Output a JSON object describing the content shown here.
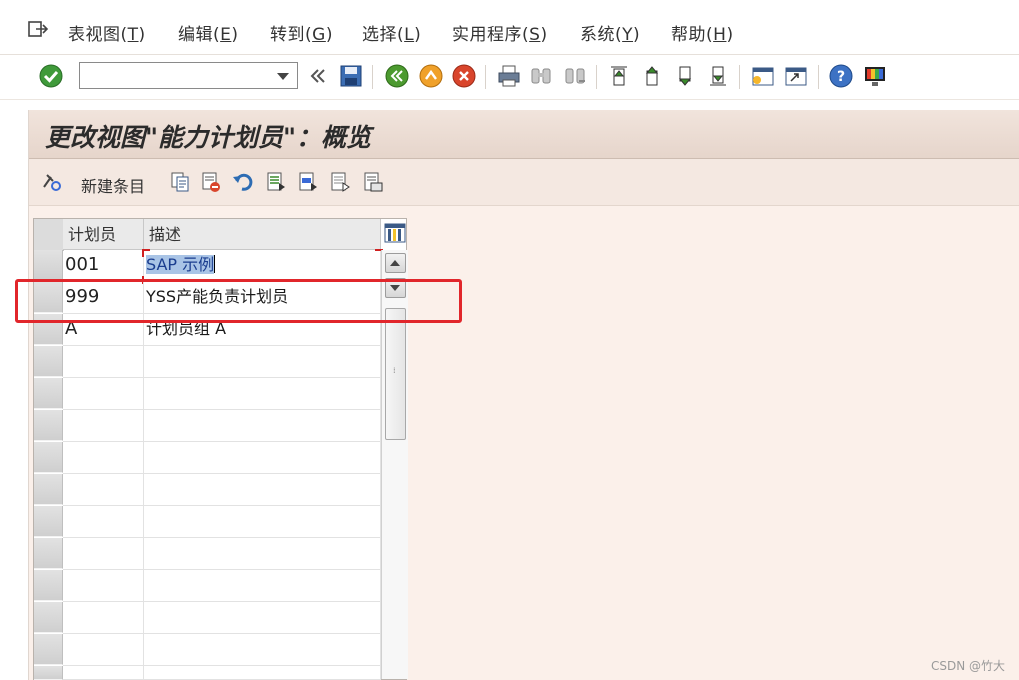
{
  "menu": [
    {
      "label": "表视图(",
      "acc": "T",
      "tail": ")"
    },
    {
      "label": "编辑(",
      "acc": "E",
      "tail": ")"
    },
    {
      "label": "转到(",
      "acc": "G",
      "tail": ")"
    },
    {
      "label": "选择(",
      "acc": "L",
      "tail": ")"
    },
    {
      "label": "实用程序(",
      "acc": "S",
      "tail": ")"
    },
    {
      "label": "系统(",
      "acc": "Y",
      "tail": ")"
    },
    {
      "label": "帮助(",
      "acc": "H",
      "tail": ")"
    }
  ],
  "command_field": {
    "value": ""
  },
  "page_title": "更改视图\"能力计划员\"：概览",
  "app_toolbar": {
    "new_entry_label": "新建条目"
  },
  "table": {
    "columns": [
      "计划员",
      "描述"
    ],
    "rows": [
      {
        "key": "001",
        "desc_selected": "SAP 示例"
      },
      {
        "key": "999",
        "desc": "YSS产能负责计划员"
      },
      {
        "key": "A",
        "desc": "计划员组 A"
      }
    ]
  },
  "watermark": "CSDN @竹大",
  "colors": {
    "title_bg": "#e6d5cb",
    "app_bg": "#fbf0ea",
    "highlight": "#e1262b",
    "focus_cell": "#fdf3a8"
  }
}
